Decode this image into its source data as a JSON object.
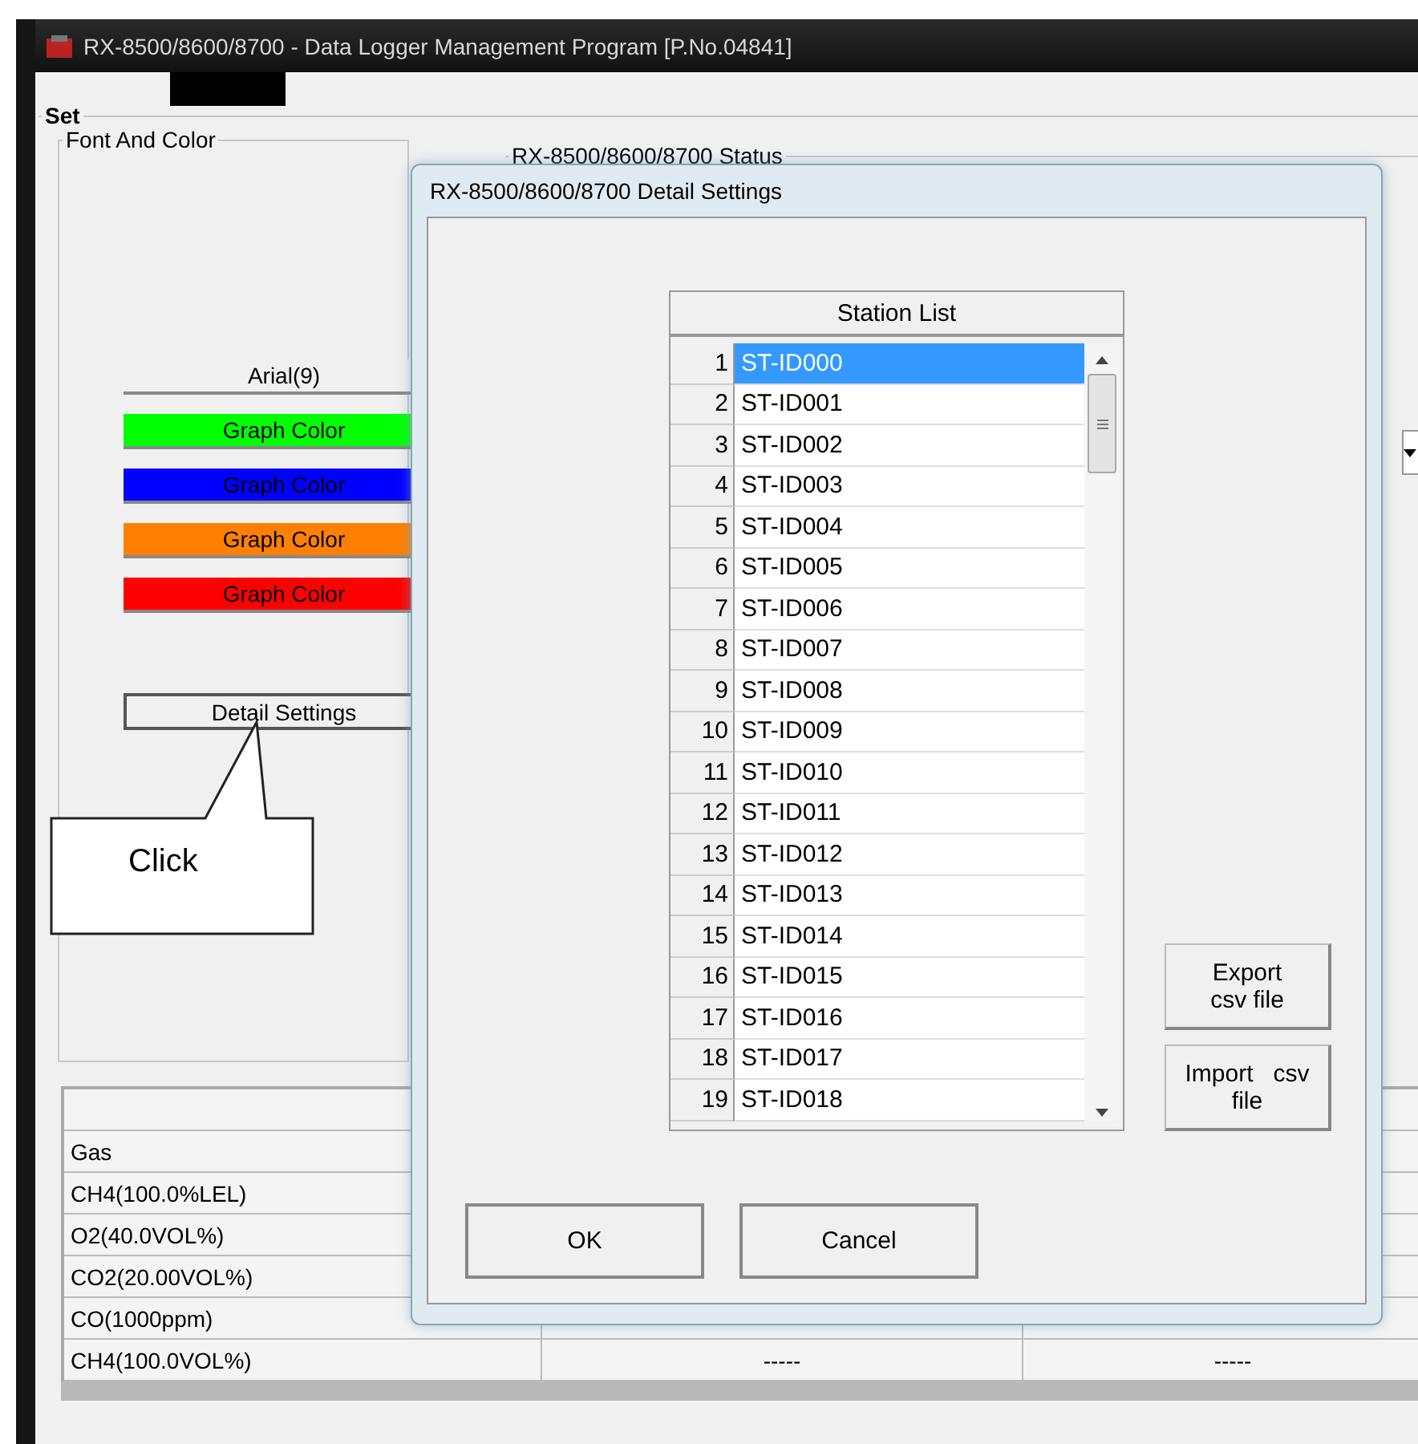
{
  "window": {
    "title": "RX-8500/8600/8700 - Data Logger Management Program [P.No.04841]"
  },
  "set_group": {
    "title": "Set"
  },
  "font_and_color": {
    "title": "Font And Color",
    "font_button": "Arial(9)",
    "color_buttons": [
      {
        "label": "Graph Color",
        "color": "#00ff00"
      },
      {
        "label": "Graph Color",
        "color": "#0000ff"
      },
      {
        "label": "Graph Color",
        "color": "#ff8000"
      },
      {
        "label": "Graph Color",
        "color": "#ff0000"
      }
    ],
    "detail_button": "Detail Settings"
  },
  "status_group": {
    "title": "RX-8500/8600/8700 Status"
  },
  "gas_table": {
    "rows": [
      {
        "label": "Gas",
        "values": []
      },
      {
        "label": "CH4(100.0%LEL)",
        "values": []
      },
      {
        "label": "O2(40.0VOL%)",
        "values": []
      },
      {
        "label": "CO2(20.00VOL%)",
        "values": []
      },
      {
        "label": "CO(1000ppm)",
        "values": []
      },
      {
        "label": "CH4(100.0VOL%)",
        "values": [
          "-----",
          "-----"
        ]
      }
    ]
  },
  "callout": {
    "text": "Click"
  },
  "dialog": {
    "title": "RX-8500/8600/8700 Detail Settings",
    "list_header": "Station List",
    "stations": [
      {
        "number": "1",
        "name": "ST-ID000",
        "selected": true
      },
      {
        "number": "2",
        "name": "ST-ID001",
        "selected": false
      },
      {
        "number": "3",
        "name": "ST-ID002",
        "selected": false
      },
      {
        "number": "4",
        "name": "ST-ID003",
        "selected": false
      },
      {
        "number": "5",
        "name": "ST-ID004",
        "selected": false
      },
      {
        "number": "6",
        "name": "ST-ID005",
        "selected": false
      },
      {
        "number": "7",
        "name": "ST-ID006",
        "selected": false
      },
      {
        "number": "8",
        "name": "ST-ID007",
        "selected": false
      },
      {
        "number": "9",
        "name": "ST-ID008",
        "selected": false
      },
      {
        "number": "10",
        "name": "ST-ID009",
        "selected": false
      },
      {
        "number": "11",
        "name": "ST-ID010",
        "selected": false
      },
      {
        "number": "12",
        "name": "ST-ID011",
        "selected": false
      },
      {
        "number": "13",
        "name": "ST-ID012",
        "selected": false
      },
      {
        "number": "14",
        "name": "ST-ID013",
        "selected": false
      },
      {
        "number": "15",
        "name": "ST-ID014",
        "selected": false
      },
      {
        "number": "16",
        "name": "ST-ID015",
        "selected": false
      },
      {
        "number": "17",
        "name": "ST-ID016",
        "selected": false
      },
      {
        "number": "18",
        "name": "ST-ID017",
        "selected": false
      },
      {
        "number": "19",
        "name": "ST-ID018",
        "selected": false
      }
    ],
    "export_button": {
      "line1": "Export",
      "line2": "csv file"
    },
    "import_button": {
      "line1": "Import   csv",
      "line2": "file"
    },
    "buttons": [
      "OK",
      "Cancel"
    ]
  }
}
